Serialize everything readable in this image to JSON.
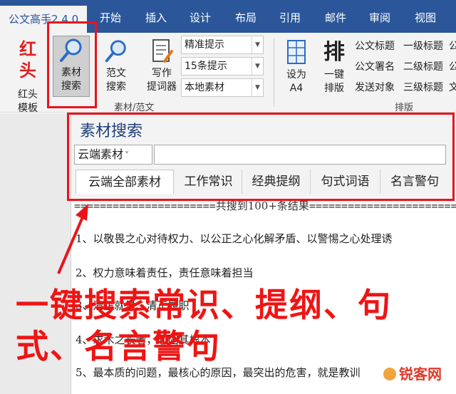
{
  "app": {
    "title_tab": "公文高手2.4.0",
    "tabs": [
      "开始",
      "插入",
      "设计",
      "布局",
      "引用",
      "邮件",
      "审阅",
      "视图"
    ]
  },
  "ribbon": {
    "red_header": {
      "logo_text": "红头",
      "label1": "红头",
      "label2": "模板"
    },
    "material_search": {
      "label1": "素材",
      "label2": "搜索"
    },
    "fanwen_search": {
      "label1": "范文",
      "label2": "搜索"
    },
    "writing_prompt": {
      "label1": "写作",
      "label2": "提词器"
    },
    "dropdowns": [
      "精准提示",
      "15条提示",
      "本地素材"
    ],
    "group_material": "素材/范文",
    "set_a4": {
      "label1": "设为",
      "label2": "A4"
    },
    "one_click": {
      "glyph": "排",
      "label1": "一键",
      "label2": "排版"
    },
    "styles_col1": [
      "公文标题",
      "公文署名",
      "发送对象"
    ],
    "styles_col2": [
      "一级标题",
      "二级标题",
      "三级标题"
    ],
    "styles_col3": [
      "公",
      "公",
      "文"
    ],
    "group_paiban": "排版"
  },
  "pane": {
    "title": "素材搜索",
    "source_select": "云端素材",
    "search_value": "",
    "tabs": [
      "云端全部素材",
      "工作常识",
      "经典提纲",
      "句式词语",
      "名言警句"
    ],
    "result_count": "共搜到100+条结果",
    "results": [
      "1、以敬畏之心对待权力、以公正之心化解矛盾、以警惕之心处理诱",
      "2、权力意味着责任，责任意味着担当",
      "3、清正就是、清正履职",
      "4、求木之长者，必固其根本",
      "5、最本质的问题，最核心的原因，最突出的危害，就是教训"
    ]
  },
  "annotation": {
    "line1": "一键搜索常识、提纲、句",
    "line2": "式、名言警句"
  },
  "watermark": "锐客网"
}
